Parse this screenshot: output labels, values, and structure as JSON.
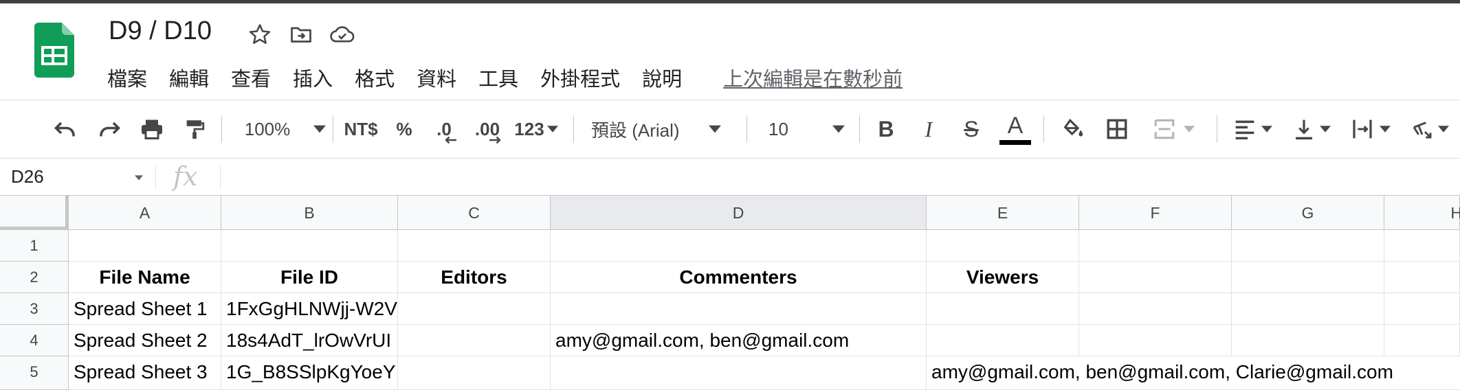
{
  "doc": {
    "title": "D9 / D10",
    "last_edit": "上次編輯是在數秒前"
  },
  "menu": [
    "檔案",
    "編輯",
    "查看",
    "插入",
    "格式",
    "資料",
    "工具",
    "外掛程式",
    "說明"
  ],
  "toolbar": {
    "zoom": "100%",
    "currency": "NT$",
    "percent": "%",
    "decrease_decimal": ".0",
    "increase_decimal": ".00",
    "more_formats": "123",
    "font": "預設 (Arial)",
    "font_size": "10",
    "text_color_letter": "A"
  },
  "formula_bar": {
    "name_box": "D26",
    "fx": "fx",
    "content": ""
  },
  "columns": [
    "A",
    "B",
    "C",
    "D",
    "E",
    "F",
    "G",
    "H"
  ],
  "selected_column": "D",
  "rows": [
    "1",
    "2",
    "3",
    "4",
    "5"
  ],
  "cells": {
    "A2": "File Name",
    "B2": "File ID",
    "C2": "Editors",
    "D2": "Commenters",
    "E2": "Viewers",
    "A3": "Spread Sheet 1",
    "B3": "1FxGgHLNWjj-W2V",
    "A4": "Spread Sheet 2",
    "B4": "18s4AdT_lrOwVrUI",
    "D4": "amy@gmail.com, ben@gmail.com",
    "A5": "Spread Sheet 3",
    "B5": "1G_B8SSlpKgYoeY",
    "E5": "amy@gmail.com, ben@gmail.com, Clarie@gmail.com"
  },
  "colors": {
    "sheets_green": "#0f9d58",
    "header_bg": "#f8f9fa",
    "selected_header_bg": "#e8eaed"
  }
}
